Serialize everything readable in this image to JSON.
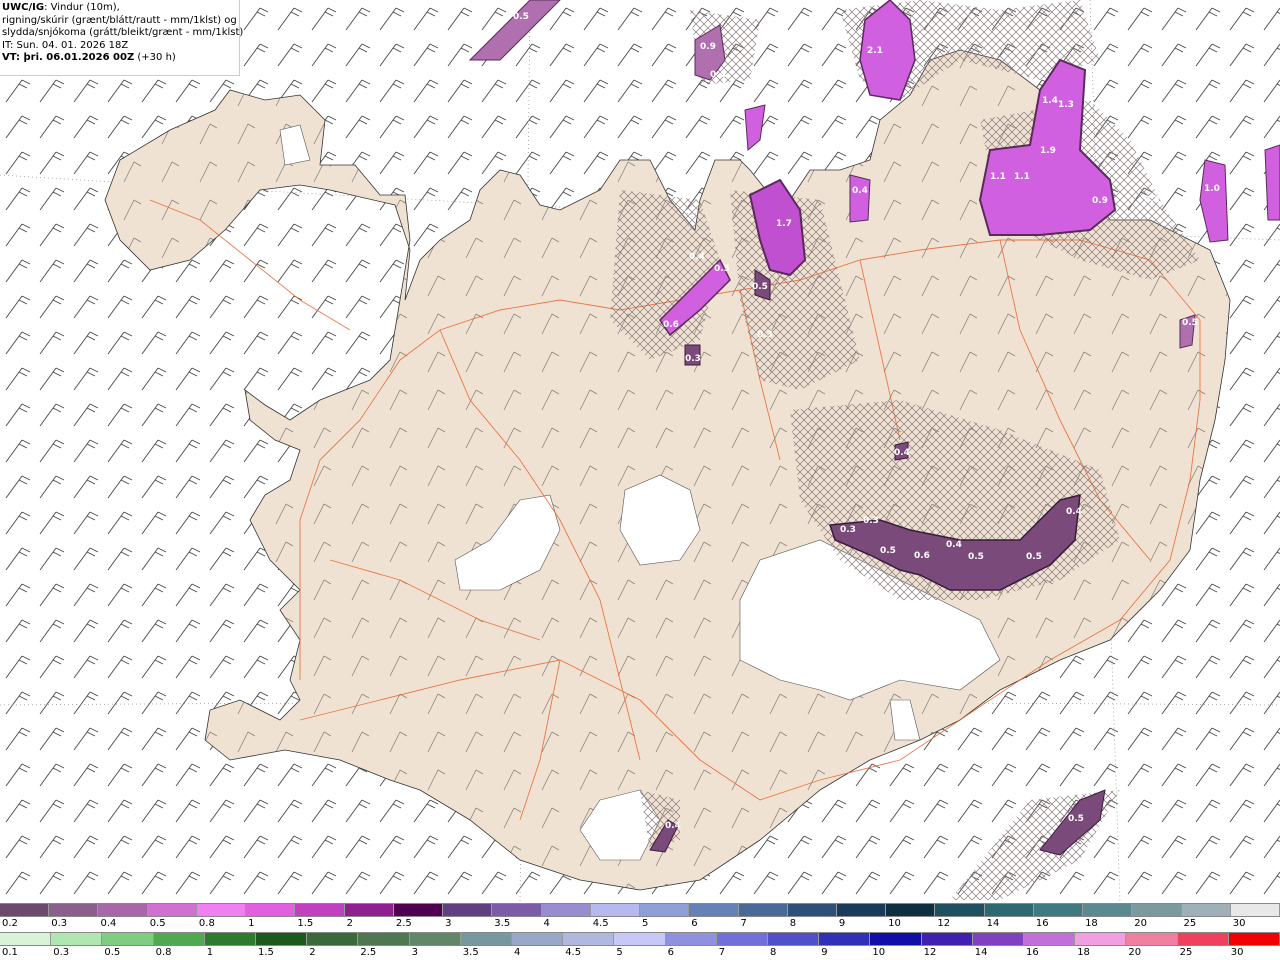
{
  "title": {
    "model": "UWC/IG",
    "line1": ": Vindur (10m),",
    "line2": "rigning/skúrir (grænt/blátt/rautt - mm/1klst) og",
    "line3": "slydda/snjókoma (grátt/bleikt/grænt - mm/1klst)",
    "line4": "IT: Sun. 04. 01. 2026 18Z",
    "line5": "VT: þri. 06.01.2026 00Z",
    "line5_suffix": " (+30 h)"
  },
  "legend": {
    "snow_scale": {
      "labels": [
        "0.2",
        "0.3",
        "0.4",
        "0.5",
        "0.8",
        "1",
        "1.5",
        "2",
        "2.5",
        "3",
        "3.5",
        "4",
        "4.5",
        "5",
        "6",
        "7",
        "8",
        "9",
        "10",
        "12",
        "14",
        "16",
        "18",
        "20",
        "25",
        "30"
      ],
      "colors": [
        "#6b4a6b",
        "#8b5f8b",
        "#a867a8",
        "#d070d0",
        "#f080f0",
        "#e060e0",
        "#c040c0",
        "#902090",
        "#500050",
        "#604080",
        "#7a5ca8",
        "#9a8cd0",
        "#b8b8f0",
        "#8fa0d8",
        "#6680b8",
        "#4a6898",
        "#2e5078",
        "#1a3a5a",
        "#0f2e3e",
        "#1e5060",
        "#2e6870",
        "#3e7a80",
        "#5a8a90",
        "#7a9aa0",
        "#a0b0b8",
        "#e8e8e8"
      ]
    },
    "rain_scale": {
      "labels": [
        "0.1",
        "0.3",
        "0.5",
        "0.8",
        "1",
        "1.5",
        "2",
        "2.5",
        "3",
        "3.5",
        "4",
        "4.5",
        "5",
        "6",
        "7",
        "8",
        "9",
        "10",
        "12",
        "14",
        "16",
        "18",
        "20",
        "25",
        "30"
      ],
      "colors": [
        "#d8f4d8",
        "#b0e6b0",
        "#80cc80",
        "#50a850",
        "#2e7a2e",
        "#1a5a1a",
        "#3a6a3a",
        "#507850",
        "#608868",
        "#7898a0",
        "#98a8c8",
        "#b0b8e0",
        "#c8c8f8",
        "#9090e0",
        "#7070d8",
        "#5050c8",
        "#3030b8",
        "#1010a8",
        "#4020b0",
        "#8040c0",
        "#c070d8",
        "#f0a0e0",
        "#f080a0",
        "#f04060",
        "#f00000"
      ]
    }
  },
  "precip_labels": [
    "0.5",
    "2.1",
    "0.9",
    "0.4",
    "1.4",
    "1.3",
    "1.9",
    "1.1",
    "1.1",
    "0.4",
    "0.9",
    "1.7",
    "0.4",
    "0.5",
    "0.6",
    "0.3",
    "0.5",
    "0.3",
    "0.2",
    "1.0",
    "0.5",
    "0.4",
    "0.3",
    "0.3",
    "0.5",
    "0.6",
    "0.4",
    "0.5",
    "0.5",
    "0.4",
    "0.5",
    "0.4"
  ],
  "colors": {
    "land": "#f0e2d2",
    "glacier": "#ffffff",
    "roads": "#e8642e",
    "snow_light": "#b070b0",
    "snow_mid": "#d060e0",
    "snow_dark": "#5a2a5a"
  }
}
